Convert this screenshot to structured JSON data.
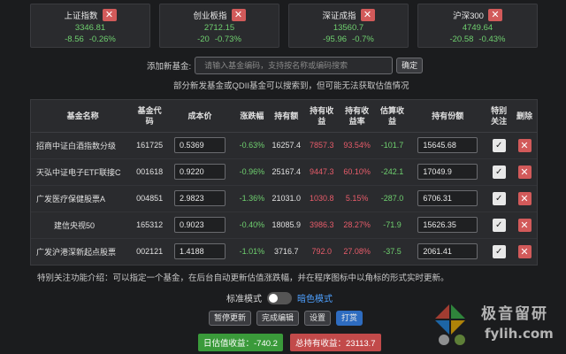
{
  "indices": [
    {
      "name": "上证指数",
      "value": "3346.81",
      "change": "-8.56",
      "pct": "-0.26%"
    },
    {
      "name": "创业板指",
      "value": "2712.15",
      "change": "-20",
      "pct": "-0.73%"
    },
    {
      "name": "深证成指",
      "value": "13560.7",
      "change": "-95.96",
      "pct": "-0.7%"
    },
    {
      "name": "沪深300",
      "value": "4749.64",
      "change": "-20.58",
      "pct": "-0.43%"
    }
  ],
  "add": {
    "label": "添加新基金:",
    "placeholder": "请输入基金编码，支持按名称或编码搜索",
    "confirm": "确定",
    "hint": "部分新发基金或QDII基金可以搜索到，但可能无法获取估值情况"
  },
  "table": {
    "headers": [
      "基金名称",
      "基金代码",
      "成本价",
      "涨跌幅",
      "持有额",
      "持有收益",
      "持有收益率",
      "估算收益",
      "持有份额",
      "特别关注",
      "删除"
    ],
    "rows": [
      {
        "name": "招商中证白酒指数分级",
        "code": "161725",
        "cost": "0.5369",
        "change": "-0.63%",
        "holding": "16257.4",
        "profit": "7857.3",
        "rate": "93.54%",
        "est": "-101.7",
        "shares": "15645.68"
      },
      {
        "name": "天弘中证电子ETF联接C",
        "code": "001618",
        "cost": "0.9220",
        "change": "-0.96%",
        "holding": "25167.4",
        "profit": "9447.3",
        "rate": "60.10%",
        "est": "-242.1",
        "shares": "17049.9"
      },
      {
        "name": "广发医疗保健股票A",
        "code": "004851",
        "cost": "2.9823",
        "change": "-1.36%",
        "holding": "21031.0",
        "profit": "1030.8",
        "rate": "5.15%",
        "est": "-287.0",
        "shares": "6706.31"
      },
      {
        "name": "建信央视50",
        "code": "165312",
        "cost": "0.9023",
        "change": "-0.40%",
        "holding": "18085.9",
        "profit": "3986.3",
        "rate": "28.27%",
        "est": "-71.9",
        "shares": "15626.35"
      },
      {
        "name": "广发沪港深新起点股票",
        "code": "002121",
        "cost": "1.4188",
        "change": "-1.01%",
        "holding": "3716.7",
        "profit": "792.0",
        "rate": "27.08%",
        "est": "-37.5",
        "shares": "2061.41"
      }
    ]
  },
  "note": "特别关注功能介绍：可以指定一个基金，在后台自动更新估值涨跌幅，并在程序图标中以角标的形式实时更新。",
  "mode": {
    "standard": "标准模式",
    "dark": "暗色模式"
  },
  "buttons": {
    "pause": "暂停更新",
    "done_edit": "完成编辑",
    "settings": "设置",
    "tip": "打赏"
  },
  "summary": {
    "daily": "日估值收益：-740.2",
    "total": "总持有收益：23113.7"
  },
  "watermark": {
    "line1": "极音留研",
    "line2": "fylih.com"
  },
  "colors": {
    "up": "#e85c6a",
    "down": "#6fd06f",
    "accent": "#4ea0ff"
  }
}
